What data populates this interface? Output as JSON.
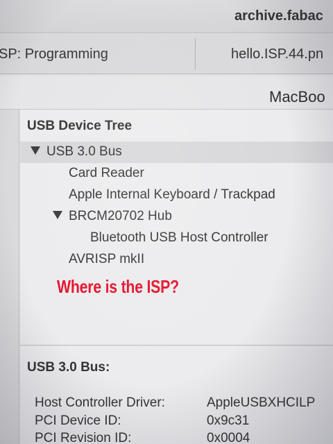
{
  "window": {
    "title": "archive.fabac"
  },
  "tabs": [
    {
      "label": "SP: Programming"
    },
    {
      "label": "hello.ISP.44.pn"
    }
  ],
  "device": {
    "name": "MacBoo"
  },
  "tree": {
    "title": "USB Device Tree",
    "items": [
      {
        "label": "USB 3.0 Bus",
        "expanded": true,
        "selected": true
      },
      {
        "label": "Card Reader"
      },
      {
        "label": "Apple Internal Keyboard / Trackpad"
      },
      {
        "label": "BRCM20702 Hub",
        "expanded": true
      },
      {
        "label": "Bluetooth USB Host Controller"
      },
      {
        "label": "AVRISP mkII"
      }
    ]
  },
  "annotation": {
    "text": "Where is the ISP?",
    "color": "#e4102a"
  },
  "details": {
    "title": "USB 3.0 Bus:",
    "rows": [
      {
        "key": "Host Controller Driver:",
        "value": "AppleUSBXHCILP"
      },
      {
        "key": "PCI Device ID:",
        "value": "0x9c31"
      },
      {
        "key": "PCI Revision ID:",
        "value": "0x0004"
      }
    ]
  }
}
